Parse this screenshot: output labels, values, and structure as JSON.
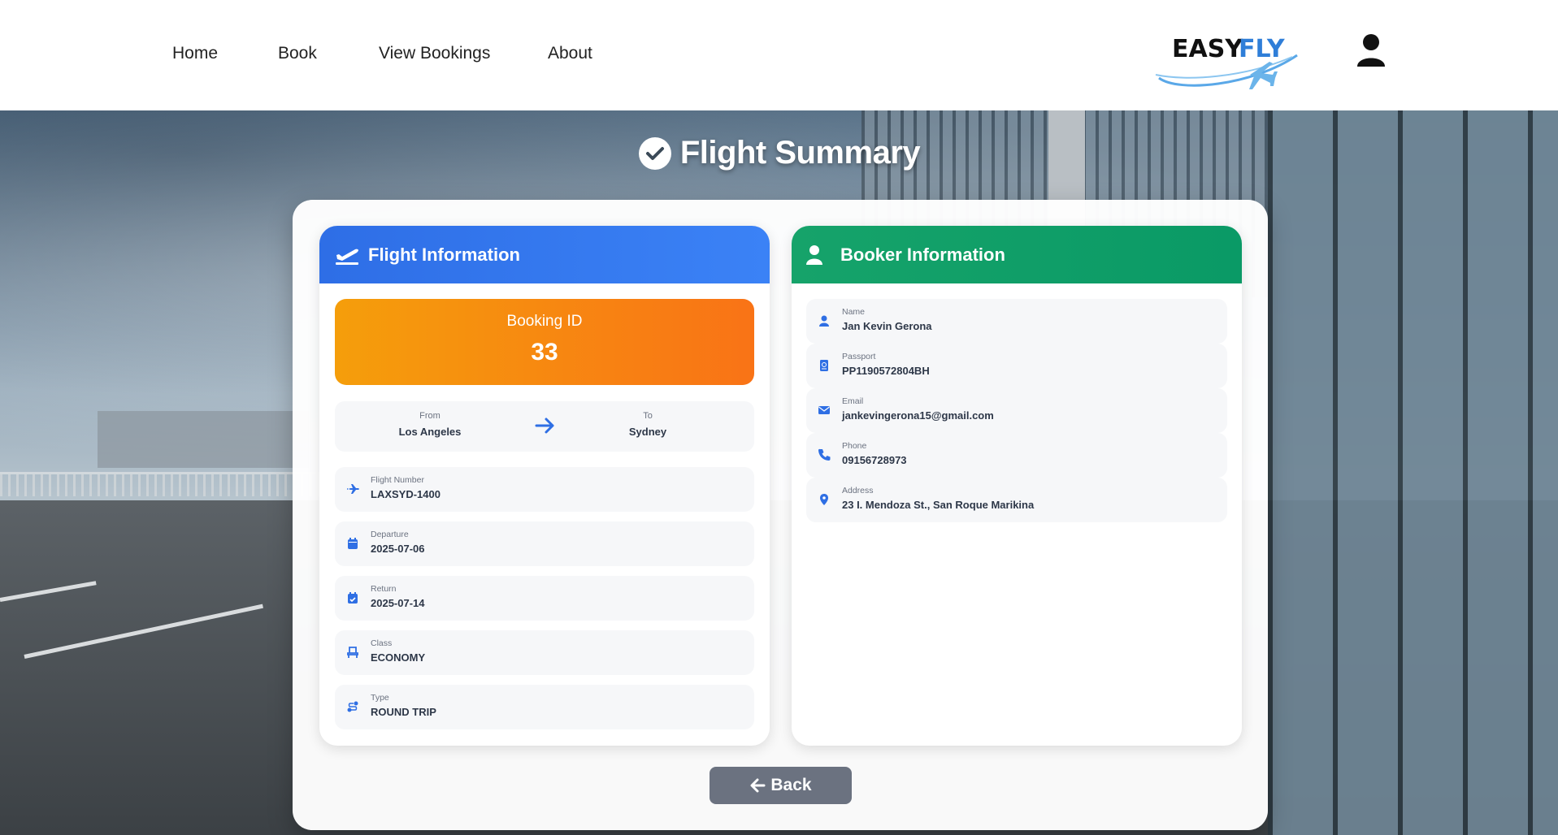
{
  "nav": {
    "links": [
      "Home",
      "Book",
      "View Bookings",
      "About"
    ],
    "logo_text_1": "EASY",
    "logo_text_2": "FLY"
  },
  "page": {
    "title": "Flight Summary"
  },
  "flight_info": {
    "title": "Flight Information",
    "booking_label": "Booking ID",
    "booking_id": "33",
    "from_label": "From",
    "from": "Los Angeles",
    "to_label": "To",
    "to": "Sydney",
    "rows": [
      {
        "label": "Flight Number",
        "value": "LAXSYD-1400",
        "icon": "plane-icon"
      },
      {
        "label": "Departure",
        "value": "2025-07-06",
        "icon": "calendar-icon"
      },
      {
        "label": "Return",
        "value": "2025-07-14",
        "icon": "calendar-check-icon"
      },
      {
        "label": "Class",
        "value": "ECONOMY",
        "icon": "seat-icon"
      },
      {
        "label": "Type",
        "value": "ROUND TRIP",
        "icon": "route-icon"
      }
    ]
  },
  "booker_info": {
    "title": "Booker Information",
    "rows": [
      {
        "label": "Name",
        "value": "Jan Kevin Gerona",
        "icon": "user-icon"
      },
      {
        "label": "Passport",
        "value": "PP1190572804BH",
        "icon": "passport-icon"
      },
      {
        "label": "Email",
        "value": "jankevingerona15@gmail.com",
        "icon": "envelope-icon"
      },
      {
        "label": "Phone",
        "value": "09156728973",
        "icon": "phone-icon"
      },
      {
        "label": "Address",
        "value": "23 I. Mendoza St., San Roque Marikina",
        "icon": "location-pin-icon"
      }
    ]
  },
  "actions": {
    "back_label": "Back"
  },
  "colors": {
    "primary_blue": "#3b82f6",
    "green": "#10a36a",
    "orange_start": "#f59e0b",
    "orange_end": "#f97316",
    "back_button": "#6b7280"
  }
}
